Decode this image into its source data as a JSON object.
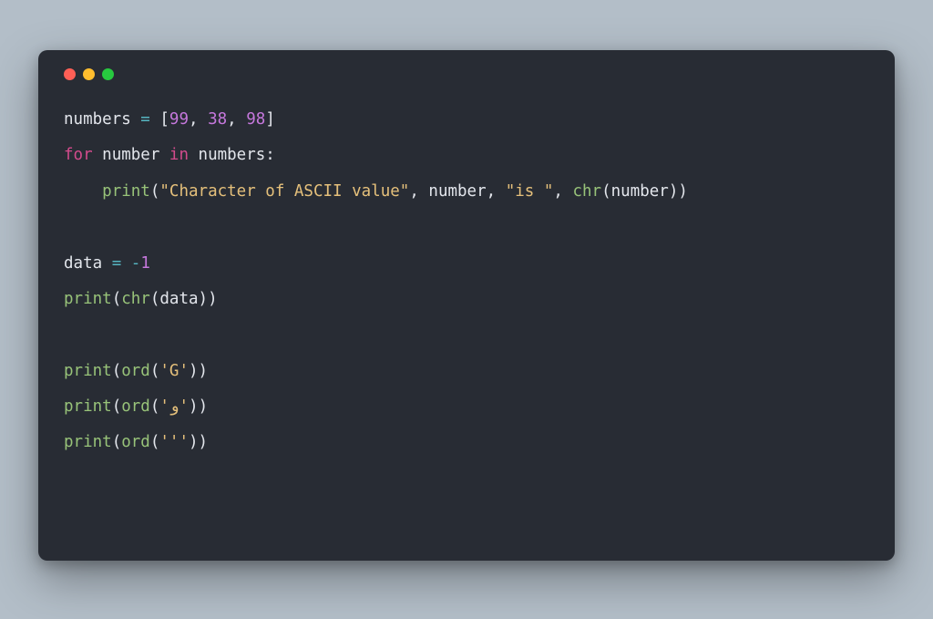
{
  "code": {
    "l1": {
      "var": "numbers",
      "eq": " = ",
      "lb": "[",
      "n1": "99",
      "c1": ", ",
      "n2": "38",
      "c2": ", ",
      "n3": "98",
      "rb": "]"
    },
    "l2": {
      "for": "for ",
      "v": "number ",
      "in": "in ",
      "iter": "numbers",
      "colon": ":"
    },
    "l3": {
      "indent": "    ",
      "fn": "print",
      "lp": "(",
      "s1": "\"Character of ASCII value\"",
      "c1": ", ",
      "a1": "number",
      "c2": ", ",
      "s2": "\"is \"",
      "c3": ", ",
      "chr": "chr",
      "lp2": "(",
      "a2": "number",
      "rp2": ")",
      "rp": ")"
    },
    "blank1": "",
    "l4": {
      "var": "data",
      "eq": " = ",
      "op": "-",
      "n": "1"
    },
    "l5": {
      "fn": "print",
      "lp": "(",
      "chr": "chr",
      "lp2": "(",
      "a": "data",
      "rp2": ")",
      "rp": ")"
    },
    "blank2": "",
    "l6": {
      "fn": "print",
      "lp": "(",
      "ord": "ord",
      "lp2": "(",
      "s": "'G'",
      "rp2": ")",
      "rp": ")"
    },
    "l7": {
      "fn": "print",
      "lp": "(",
      "ord": "ord",
      "lp2": "(",
      "s": "'و'",
      "rp2": ")",
      "rp": ")"
    },
    "l8": {
      "fn": "print",
      "lp": "(",
      "ord": "ord",
      "lp2": "(",
      "s": "'''",
      "rp2": ")",
      "rp": ")"
    }
  }
}
